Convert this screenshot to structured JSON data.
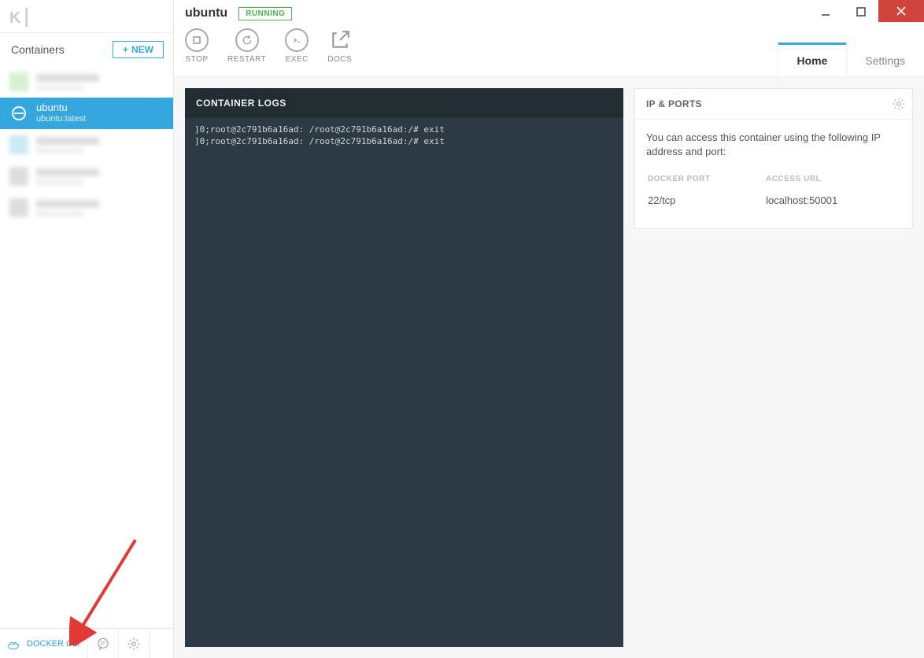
{
  "sidebar": {
    "header": "Containers",
    "new_label": "NEW",
    "active": {
      "name": "ubuntu",
      "sub": "ubuntu:latest"
    }
  },
  "bottom": {
    "docker_cli": "DOCKER CLI"
  },
  "header": {
    "title": "ubuntu",
    "status": "RUNNING",
    "actions": {
      "stop": "STOP",
      "restart": "RESTART",
      "exec": "EXEC",
      "docs": "DOCS"
    },
    "tabs": {
      "home": "Home",
      "settings": "Settings"
    }
  },
  "logs": {
    "title": "CONTAINER LOGS",
    "lines": [
      "]0;root@2c791b6a16ad: /root@2c791b6a16ad:/# exit",
      "]0;root@2c791b6a16ad: /root@2c791b6a16ad:/# exit"
    ]
  },
  "ip": {
    "title": "IP & PORTS",
    "desc": "You can access this container using the following IP address and port:",
    "col_port": "DOCKER PORT",
    "col_url": "ACCESS URL",
    "rows": [
      {
        "port": "22/tcp",
        "url": "localhost:50001"
      }
    ]
  }
}
